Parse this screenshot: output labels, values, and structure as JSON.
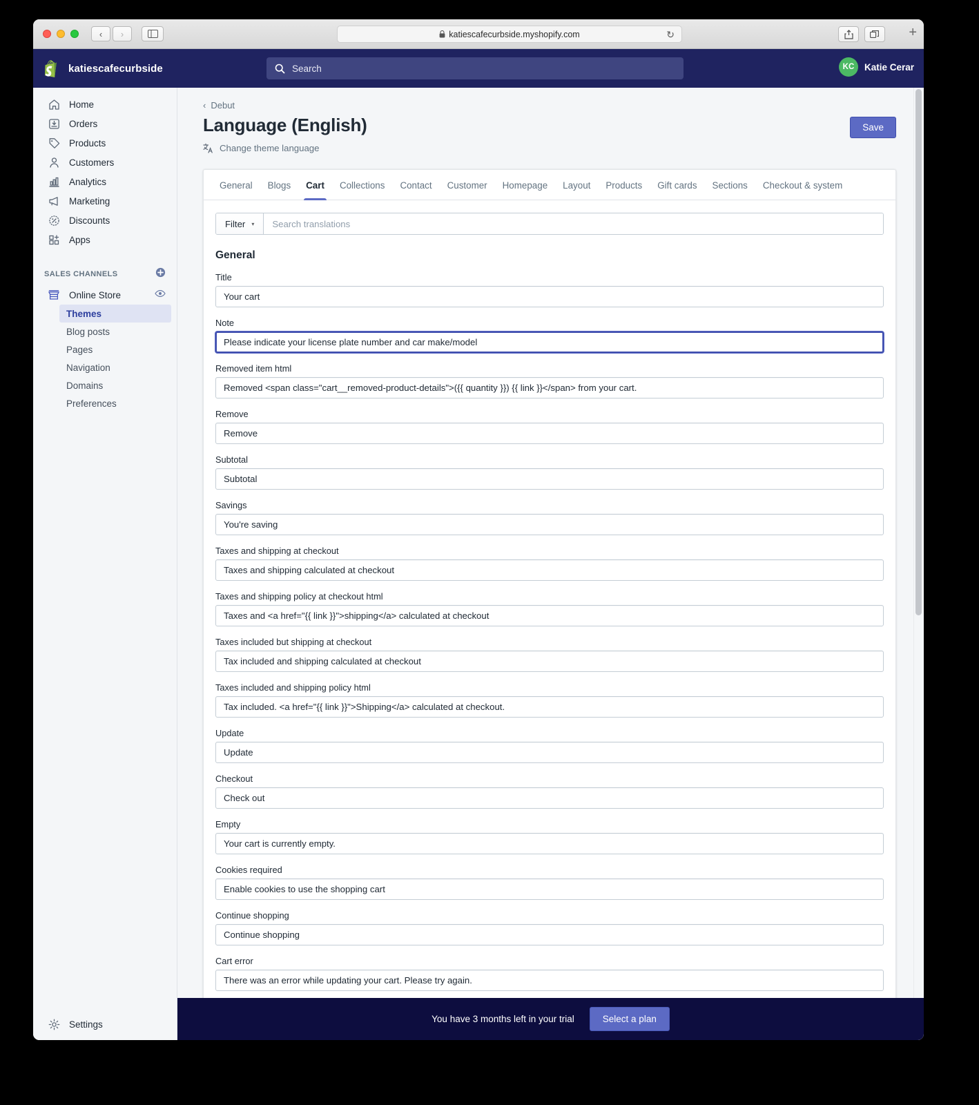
{
  "browser": {
    "url": "katiescafecurbside.myshopify.com",
    "back_label": "‹",
    "forward_label": "›",
    "reload_label": "↻",
    "new_tab_label": "+"
  },
  "topbar": {
    "store_name": "katiescafecurbside",
    "search_placeholder": "Search",
    "user": {
      "initials": "KC",
      "name": "Katie Cerar"
    }
  },
  "sidebar": {
    "items": [
      {
        "label": "Home",
        "icon": "home-icon"
      },
      {
        "label": "Orders",
        "icon": "orders-icon"
      },
      {
        "label": "Products",
        "icon": "products-icon"
      },
      {
        "label": "Customers",
        "icon": "customers-icon"
      },
      {
        "label": "Analytics",
        "icon": "analytics-icon"
      },
      {
        "label": "Marketing",
        "icon": "marketing-icon"
      },
      {
        "label": "Discounts",
        "icon": "discounts-icon"
      },
      {
        "label": "Apps",
        "icon": "apps-icon"
      }
    ],
    "sales_channels_heading": "SALES CHANNELS",
    "online_store": {
      "label": "Online Store",
      "icon": "store-icon"
    },
    "sub_items": [
      {
        "label": "Themes",
        "active": true
      },
      {
        "label": "Blog posts",
        "active": false
      },
      {
        "label": "Pages",
        "active": false
      },
      {
        "label": "Navigation",
        "active": false
      },
      {
        "label": "Domains",
        "active": false
      },
      {
        "label": "Preferences",
        "active": false
      }
    ],
    "settings": {
      "label": "Settings",
      "icon": "gear-icon"
    }
  },
  "page": {
    "breadcrumb": "Debut",
    "title": "Language (English)",
    "change_language_link": "Change theme language",
    "save_label": "Save"
  },
  "tabs": [
    {
      "label": "General",
      "active": false
    },
    {
      "label": "Blogs",
      "active": false
    },
    {
      "label": "Cart",
      "active": true
    },
    {
      "label": "Collections",
      "active": false
    },
    {
      "label": "Contact",
      "active": false
    },
    {
      "label": "Customer",
      "active": false
    },
    {
      "label": "Homepage",
      "active": false
    },
    {
      "label": "Layout",
      "active": false
    },
    {
      "label": "Products",
      "active": false
    },
    {
      "label": "Gift cards",
      "active": false
    },
    {
      "label": "Sections",
      "active": false
    },
    {
      "label": "Checkout & system",
      "active": false
    }
  ],
  "filterbar": {
    "filter_label": "Filter",
    "caret": "▾",
    "search_placeholder": "Search translations",
    "search_value": ""
  },
  "content": {
    "group_title": "General",
    "fields": [
      {
        "label": "Title",
        "value": "Your cart",
        "focused": false
      },
      {
        "label": "Note",
        "value": "Please indicate your license plate number and car make/model",
        "focused": true
      },
      {
        "label": "Removed item html",
        "value": "Removed <span class=\"cart__removed-product-details\">({{ quantity }}) {{ link }}</span> from your cart.",
        "focused": false
      },
      {
        "label": "Remove",
        "value": "Remove",
        "focused": false
      },
      {
        "label": "Subtotal",
        "value": "Subtotal",
        "focused": false
      },
      {
        "label": "Savings",
        "value": "You're saving",
        "focused": false
      },
      {
        "label": "Taxes and shipping at checkout",
        "value": "Taxes and shipping calculated at checkout",
        "focused": false
      },
      {
        "label": "Taxes and shipping policy at checkout html",
        "value": "Taxes and <a href=\"{{ link }}\">shipping</a> calculated at checkout",
        "focused": false
      },
      {
        "label": "Taxes included but shipping at checkout",
        "value": "Tax included and shipping calculated at checkout",
        "focused": false
      },
      {
        "label": "Taxes included and shipping policy html",
        "value": "Tax included. <a href=\"{{ link }}\">Shipping</a> calculated at checkout.",
        "focused": false
      },
      {
        "label": "Update",
        "value": "Update",
        "focused": false
      },
      {
        "label": "Checkout",
        "value": "Check out",
        "focused": false
      },
      {
        "label": "Empty",
        "value": "Your cart is currently empty.",
        "focused": false
      },
      {
        "label": "Cookies required",
        "value": "Enable cookies to use the shopping cart",
        "focused": false
      },
      {
        "label": "Continue shopping",
        "value": "Continue shopping",
        "focused": false
      },
      {
        "label": "Cart error",
        "value": "There was an error while updating your cart. Please try again.",
        "focused": false
      }
    ]
  },
  "trial": {
    "message": "You have 3 months left in your trial",
    "button_label": "Select a plan"
  },
  "colors": {
    "brand_navy": "#1f2360",
    "accent_indigo": "#5c6ac4",
    "trial_bar": "#0d0d3f",
    "avatar_green": "#4cb964",
    "sidebar_bg": "#f4f6f8"
  }
}
